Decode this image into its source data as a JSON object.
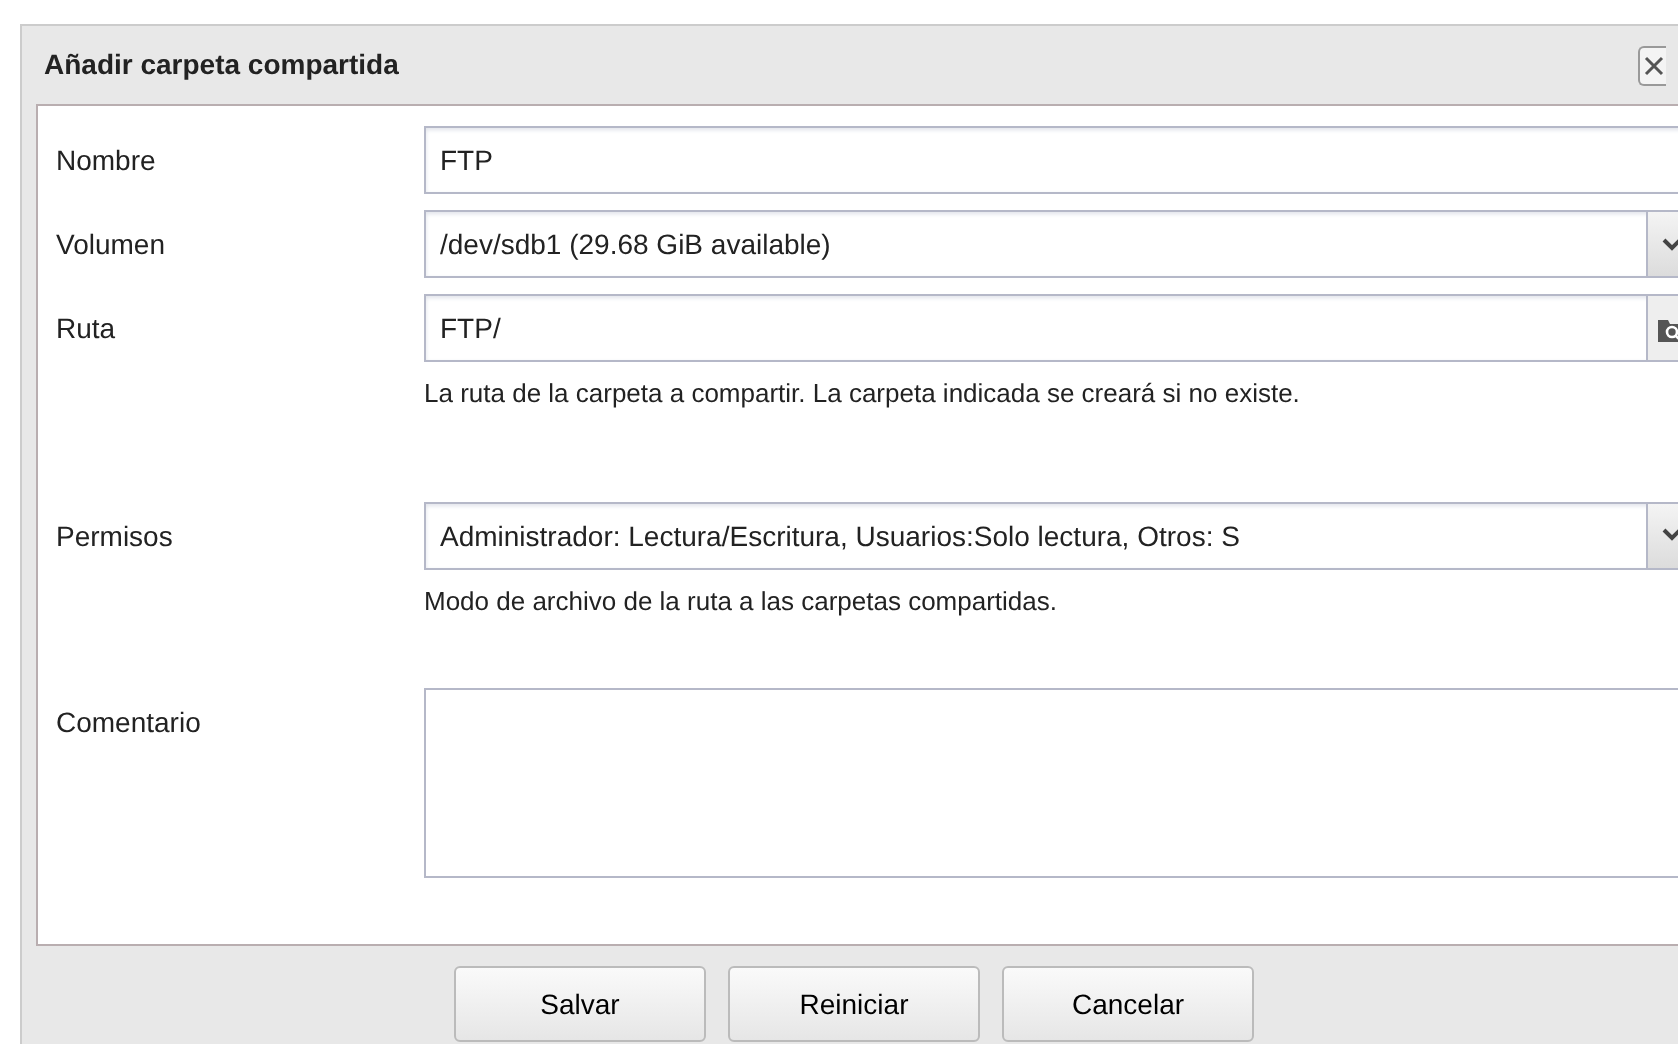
{
  "window": {
    "title": "Añadir carpeta compartida"
  },
  "fields": [
    {
      "kind": "text",
      "label": "Nombre",
      "value": "FTP"
    },
    {
      "kind": "select",
      "label": "Volumen",
      "value": "/dev/sdb1 (29.68 GiB available)"
    },
    {
      "kind": "path",
      "label": "Ruta",
      "value": "FTP/",
      "help": "La ruta de la carpeta a compartir. La carpeta indicada se creará si no existe."
    },
    {
      "kind": "select",
      "label": "Permisos",
      "value": "Administrador: Lectura/Escritura, Usuarios:Solo lectura, Otros: S",
      "help": "Modo de archivo de la ruta a las carpetas compartidas."
    },
    {
      "kind": "textarea",
      "label": "Comentario"
    }
  ],
  "buttons": [
    "Salvar",
    "Reiniciar",
    "Cancelar"
  ]
}
